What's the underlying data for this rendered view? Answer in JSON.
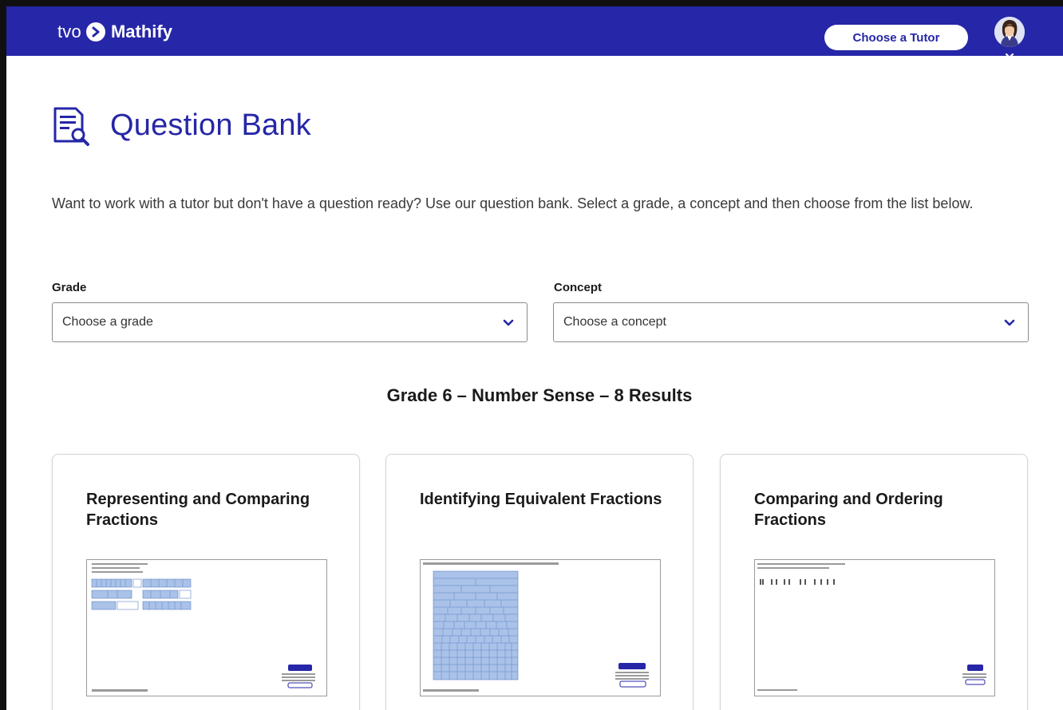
{
  "header": {
    "brand_tvo": "tvo",
    "brand_app": "Mathify",
    "choose_tutor_label": "Choose a Tutor",
    "colors": {
      "bar": "#2626a8",
      "accent": "#2626a8"
    }
  },
  "page": {
    "title": "Question Bank",
    "intro": "Want to work with a tutor but don't have a question ready? Use our question bank. Select a grade, a concept and then choose from the list below."
  },
  "filters": {
    "grade_label": "Grade",
    "grade_value": "Choose a grade",
    "concept_label": "Concept",
    "concept_value": "Choose a concept"
  },
  "results": {
    "heading": "Grade 6 – Number Sense – 8 Results",
    "cards": [
      {
        "title": "Representing and Comparing Fractions"
      },
      {
        "title": "Identifying Equivalent Fractions"
      },
      {
        "title": "Comparing and Ordering Fractions"
      }
    ]
  }
}
